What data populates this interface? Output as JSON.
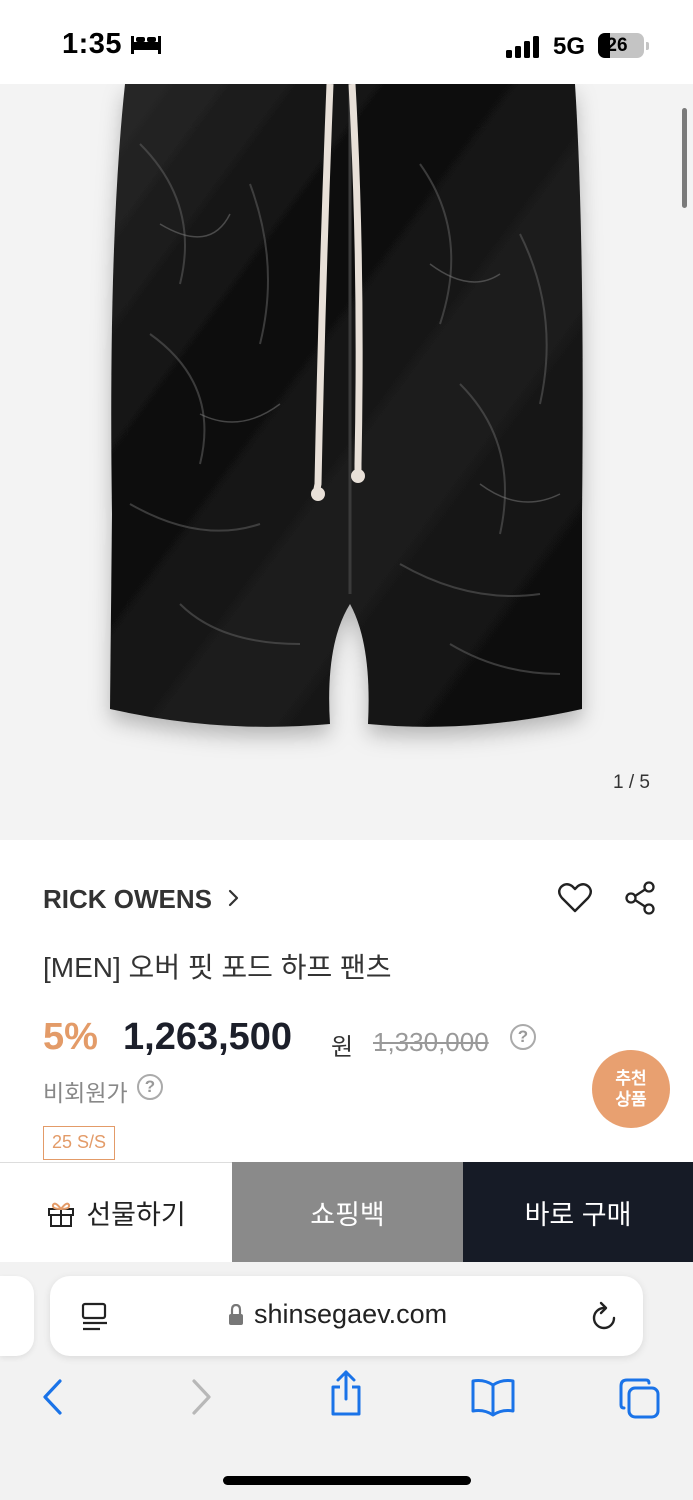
{
  "status_bar": {
    "time": "1:35",
    "network": "5G",
    "battery_level": "26",
    "battery_fraction": 0.26
  },
  "product_image": {
    "counter": "1 / 5"
  },
  "product": {
    "brand": "RICK OWENS",
    "name": "[MEN] 오버 핏 포드 하프 팬츠",
    "discount": "5%",
    "price": "1,263,500",
    "currency": "원",
    "original_price": "1,330,000",
    "help_glyph": "?",
    "member_price_label": "비회원가",
    "season": "25 S/S",
    "recommend_line1": "추천",
    "recommend_line2": "상품",
    "accent_color": "#e39b68"
  },
  "purchase_bar": {
    "gift_label": "선물하기",
    "bag_label": "쇼핑백",
    "buy_label": "바로 구매"
  },
  "browser": {
    "url": "shinsegaev.com"
  },
  "icons": [
    "bed-icon",
    "signal-icon",
    "chevron-right-icon",
    "heart-icon",
    "share-icon",
    "gift-icon",
    "reader-icon",
    "lock-icon",
    "reload-icon",
    "back-icon",
    "forward-icon",
    "share-sheet-icon",
    "bookmarks-icon",
    "tabs-icon"
  ]
}
